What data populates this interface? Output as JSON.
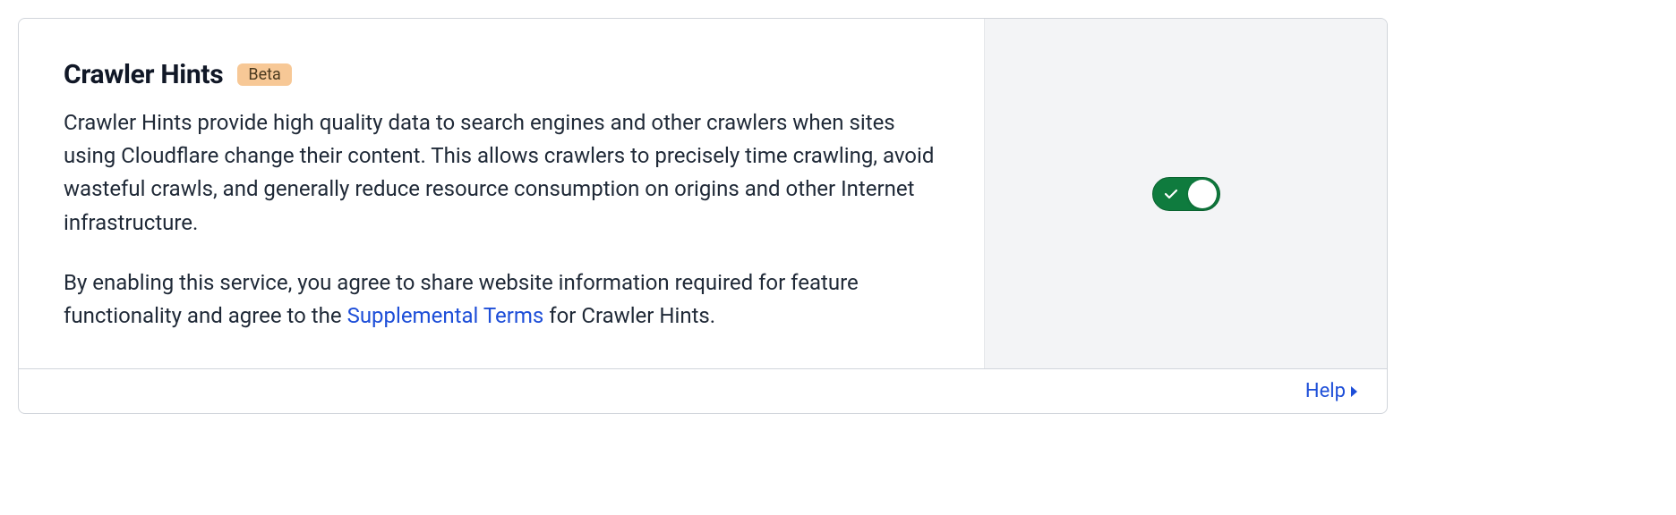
{
  "card": {
    "title": "Crawler Hints",
    "badge": "Beta",
    "description1": "Crawler Hints provide high quality data to search engines and other crawlers when sites using Cloudflare change their content. This allows crawlers to precisely time crawling, avoid wasteful crawls, and generally reduce resource consumption on origins and other Internet infrastructure.",
    "description2_pre": "By enabling this service, you agree to share website information required for feature functionality and agree to the ",
    "description2_link": "Supplemental Terms",
    "description2_post": " for Crawler Hints.",
    "toggle_on": true
  },
  "footer": {
    "help_label": "Help"
  }
}
